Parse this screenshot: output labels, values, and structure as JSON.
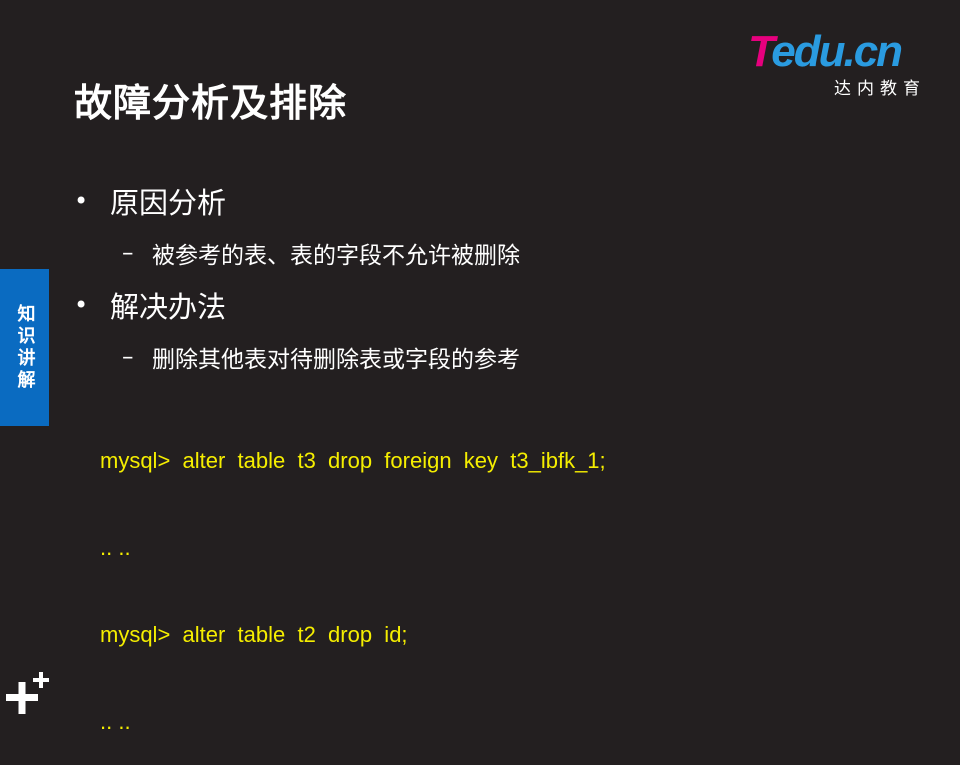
{
  "title": "故障分析及排除",
  "logo": {
    "word_t": "T",
    "word_rest": "edu.cn",
    "subtitle": "达内教育"
  },
  "side_tab": {
    "label": "知识讲解"
  },
  "bullets": [
    {
      "text": "原因分析",
      "sub": "被参考的表、表的字段不允许被删除"
    },
    {
      "text": "解决办法",
      "sub": "删除其他表对待删除表或字段的参考"
    }
  ],
  "code_lines": [
    "mysql>  alter  table  t3  drop  foreign  key  t3_ibfk_1;",
    ".. ..",
    "mysql>  alter  table  t2  drop  id;",
    ".. .."
  ],
  "symbols": {
    "bullet": "•",
    "dash": "–"
  },
  "colors": {
    "background": "#231f20",
    "code": "#f5ee00",
    "side_tab": "#0a6bc1",
    "logo_t": "#e6007e",
    "logo_text": "#2a9be0"
  },
  "icons": {
    "corner": "plus-plus-icon"
  }
}
